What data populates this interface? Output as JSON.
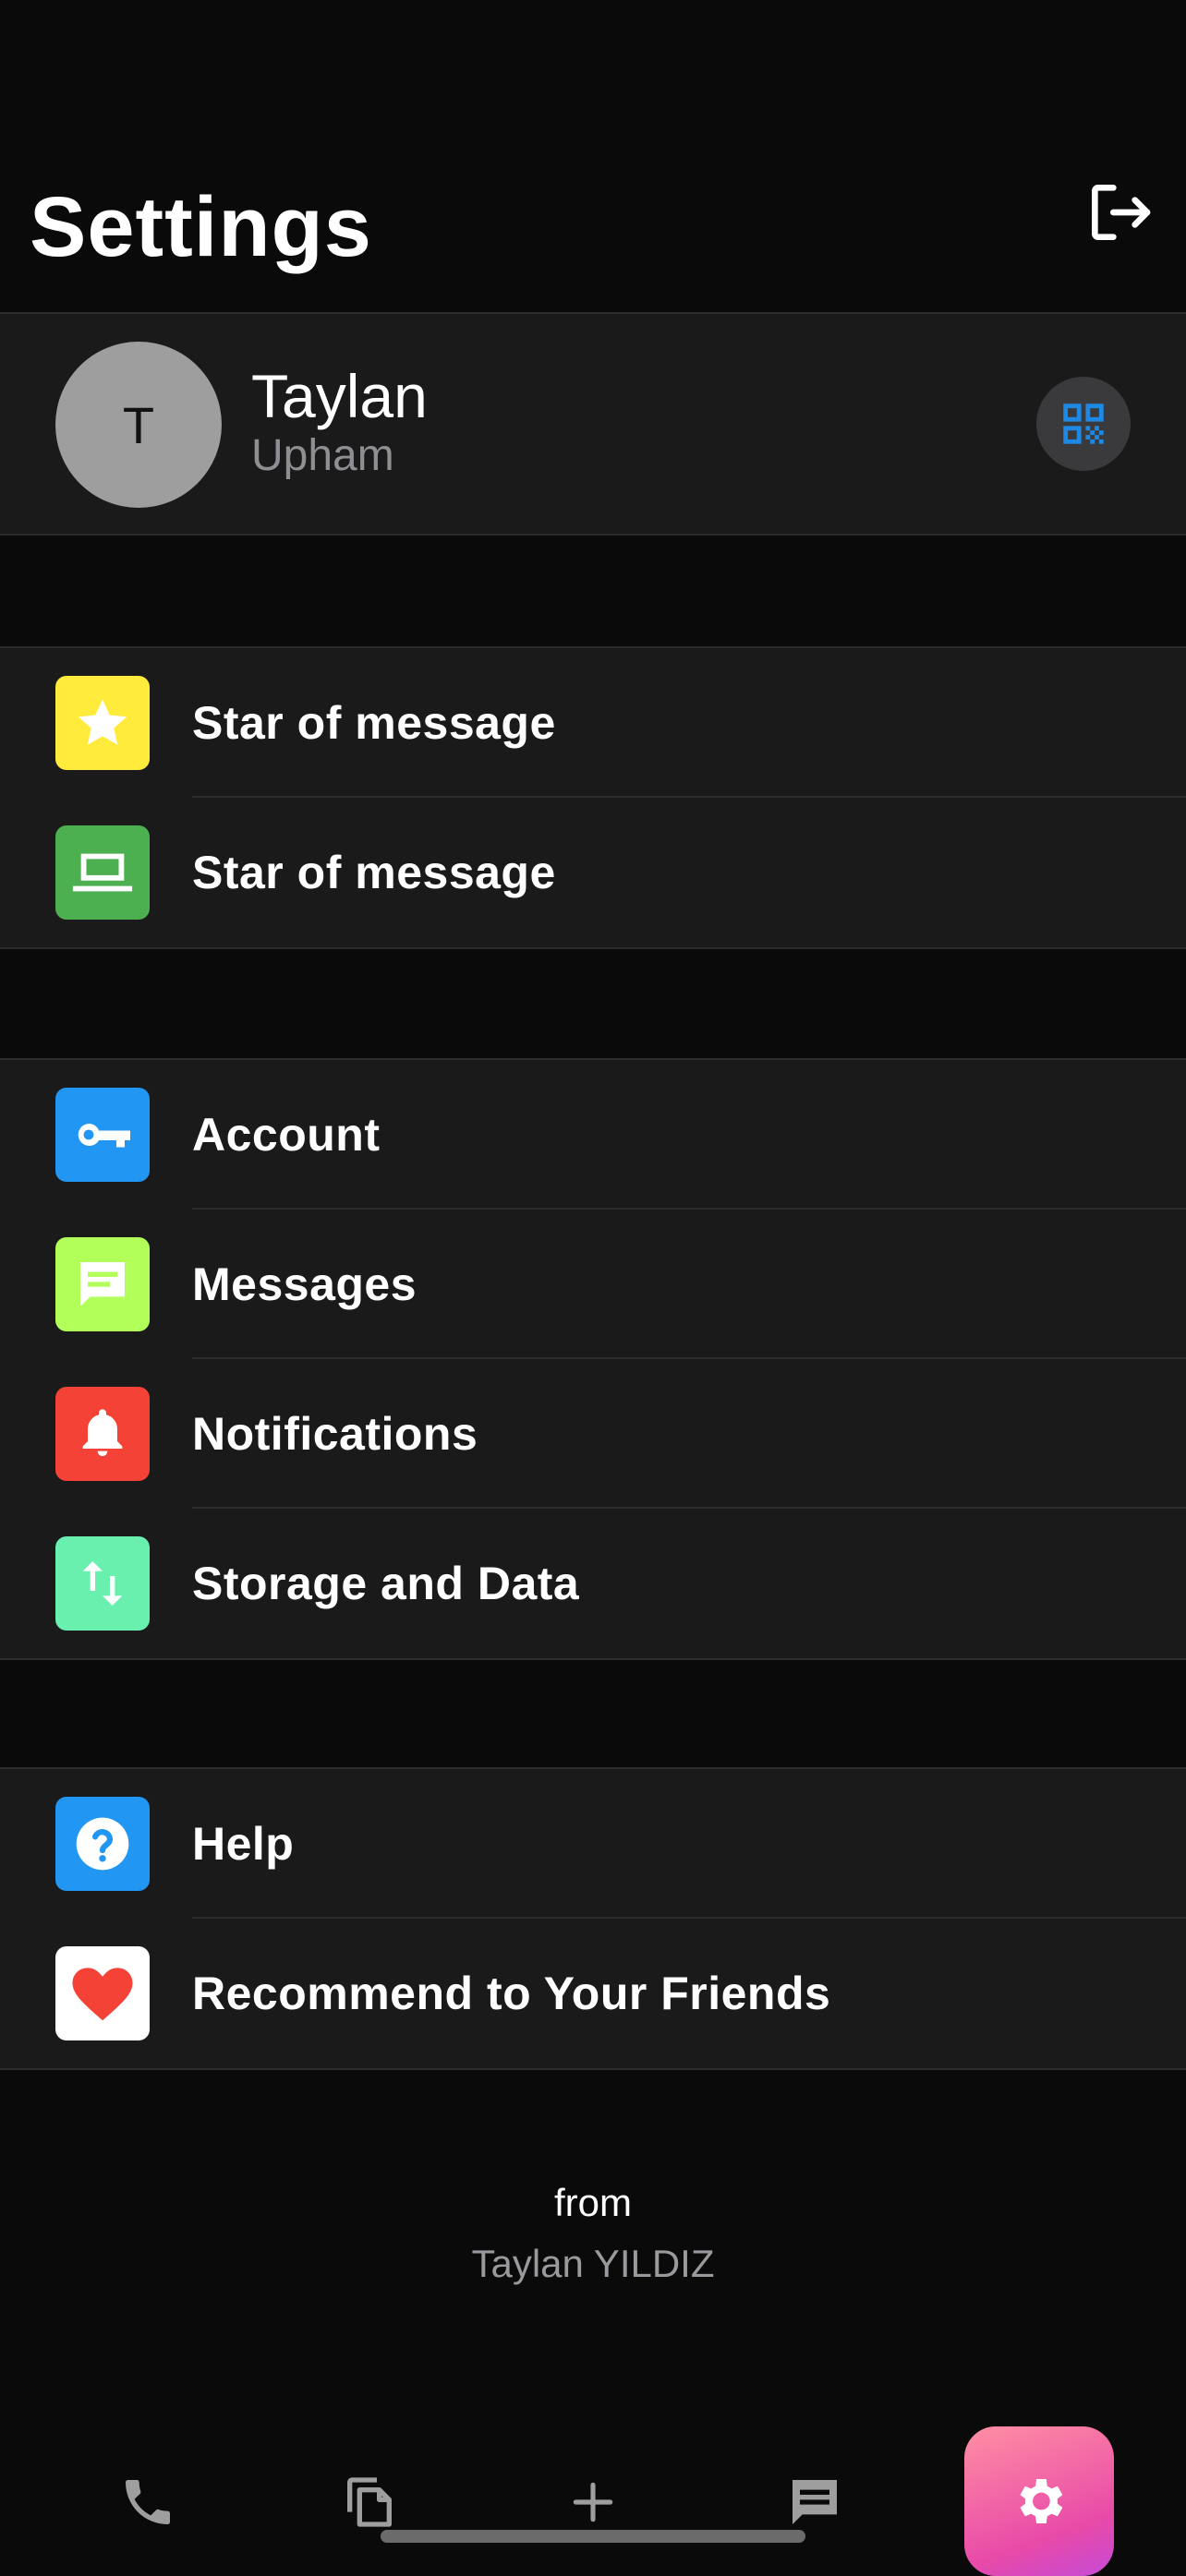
{
  "header": {
    "title": "Settings",
    "logout_icon": "logout-icon"
  },
  "profile": {
    "initial": "T",
    "name": "Taylan",
    "subtitle": "Upham",
    "qr_icon": "qr-code-icon"
  },
  "groups": [
    {
      "items": [
        {
          "label": "Star of message",
          "icon": "star-icon",
          "color": "#ffeb3b"
        },
        {
          "label": "Star of message",
          "icon": "laptop-icon",
          "color": "#4caf50"
        }
      ]
    },
    {
      "items": [
        {
          "label": "Account",
          "icon": "key-icon",
          "color": "#2196f3"
        },
        {
          "label": "Messages",
          "icon": "chat-icon",
          "color": "#b2ff59"
        },
        {
          "label": "Notifications",
          "icon": "bell-icon",
          "color": "#f44336"
        },
        {
          "label": "Storage and Data",
          "icon": "swap-vertical-icon",
          "color": "#69f0ae"
        }
      ]
    },
    {
      "items": [
        {
          "label": "Help",
          "icon": "help-icon",
          "color": "#2196f3"
        },
        {
          "label": "Recommend to Your Friends",
          "icon": "heart-icon",
          "color": "#ffffff"
        }
      ]
    }
  ],
  "footer": {
    "from": "from",
    "author": "Taylan YILDIZ"
  },
  "tabbar": {
    "tabs": [
      "phone-icon",
      "copy-icon",
      "plus-icon",
      "message-icon",
      "settings-icon"
    ],
    "active": "settings-icon"
  }
}
